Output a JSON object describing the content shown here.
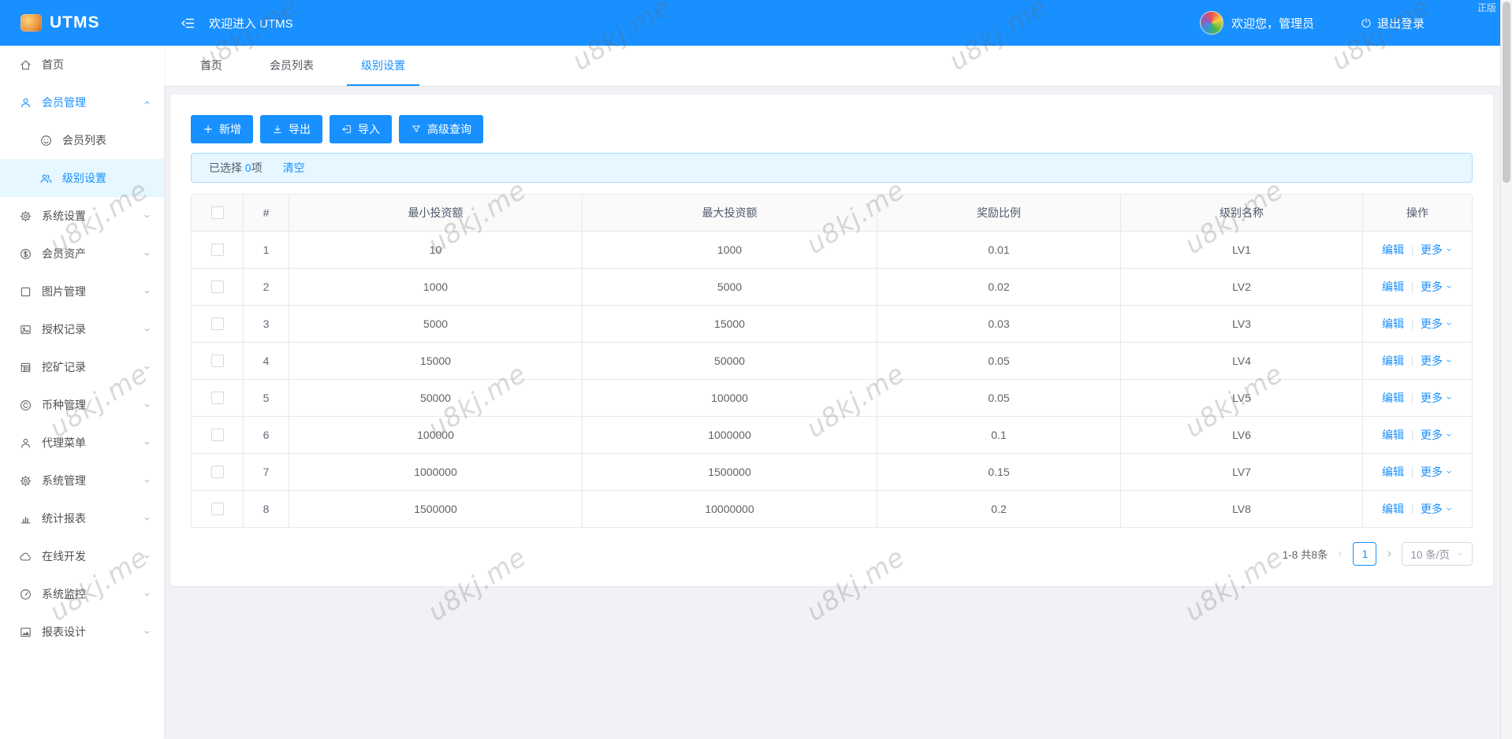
{
  "colors": {
    "accent": "#1890ff",
    "header_bg": "#1890ff",
    "selected_bg": "#e6f7ff",
    "alert_bg": "#e6f7ff"
  },
  "watermark": {
    "text": "u8kj.me",
    "corner_text": "正版"
  },
  "header": {
    "logo_text": "UTMS",
    "welcome": "欢迎进入 UTMS",
    "user_greeting": "欢迎您，管理员",
    "logout": "退出登录"
  },
  "sidebar": {
    "items": [
      {
        "label": "首页",
        "icon": "home-icon",
        "level": 1
      },
      {
        "label": "会员管理",
        "icon": "user-icon",
        "level": 1,
        "active": true,
        "chevron": "up"
      },
      {
        "label": "会员列表",
        "icon": "smile-icon",
        "level": 2
      },
      {
        "label": "级别设置",
        "icon": "team-icon",
        "level": 2,
        "selected": true
      },
      {
        "label": "系统设置",
        "icon": "gear-icon",
        "level": 1,
        "chevron": "down"
      },
      {
        "label": "会员资产",
        "icon": "dollar-icon",
        "level": 1,
        "chevron": "down"
      },
      {
        "label": "图片管理",
        "icon": "square-icon",
        "level": 1,
        "chevron": "down"
      },
      {
        "label": "授权记录",
        "icon": "picture-icon",
        "level": 1,
        "chevron": "down"
      },
      {
        "label": "挖矿记录",
        "icon": "grid-icon",
        "level": 1,
        "chevron": "down"
      },
      {
        "label": "币种管理",
        "icon": "copyright-icon",
        "level": 1,
        "chevron": "down"
      },
      {
        "label": "代理菜单",
        "icon": "agent-user-icon",
        "level": 1,
        "chevron": "down"
      },
      {
        "label": "系统管理",
        "icon": "gear-icon",
        "level": 1,
        "chevron": "down"
      },
      {
        "label": "统计报表",
        "icon": "bar-chart-icon",
        "level": 1,
        "chevron": "down"
      },
      {
        "label": "在线开发",
        "icon": "cloud-icon",
        "level": 1,
        "chevron": "down"
      },
      {
        "label": "系统监控",
        "icon": "gauge-icon",
        "level": 1,
        "chevron": "down"
      },
      {
        "label": "报表设计",
        "icon": "area-chart-icon",
        "level": 1,
        "chevron": "down"
      }
    ]
  },
  "tabs": [
    {
      "label": "首页",
      "active": false
    },
    {
      "label": "会员列表",
      "active": false
    },
    {
      "label": "级别设置",
      "active": true
    }
  ],
  "toolbar": {
    "buttons": [
      {
        "label": "新增",
        "icon": "plus-icon",
        "name": "add-button"
      },
      {
        "label": "导出",
        "icon": "download-icon",
        "name": "export-button"
      },
      {
        "label": "导入",
        "icon": "import-icon",
        "name": "import-button"
      },
      {
        "label": "高级查询",
        "icon": "filter-icon",
        "name": "advanced-query-button"
      }
    ]
  },
  "selection_bar": {
    "prefix": "已选择",
    "count": "0",
    "suffix": "项",
    "clear": "清空"
  },
  "table": {
    "columns": [
      "#",
      "最小投资额",
      "最大投资额",
      "奖励比例",
      "级别名称",
      "操作"
    ],
    "rows": [
      {
        "index": "1",
        "min": "10",
        "max": "1000",
        "ratio": "0.01",
        "level": "LV1"
      },
      {
        "index": "2",
        "min": "1000",
        "max": "5000",
        "ratio": "0.02",
        "level": "LV2"
      },
      {
        "index": "3",
        "min": "5000",
        "max": "15000",
        "ratio": "0.03",
        "level": "LV3"
      },
      {
        "index": "4",
        "min": "15000",
        "max": "50000",
        "ratio": "0.05",
        "level": "LV4"
      },
      {
        "index": "5",
        "min": "50000",
        "max": "100000",
        "ratio": "0.05",
        "level": "LV5"
      },
      {
        "index": "6",
        "min": "100000",
        "max": "1000000",
        "ratio": "0.1",
        "level": "LV6"
      },
      {
        "index": "7",
        "min": "1000000",
        "max": "1500000",
        "ratio": "0.15",
        "level": "LV7"
      },
      {
        "index": "8",
        "min": "1500000",
        "max": "10000000",
        "ratio": "0.2",
        "level": "LV8"
      }
    ],
    "actions": {
      "edit": "编辑",
      "more": "更多"
    }
  },
  "pagination": {
    "total": "1-8 共8条",
    "page": "1",
    "page_size": "10 条/页"
  }
}
